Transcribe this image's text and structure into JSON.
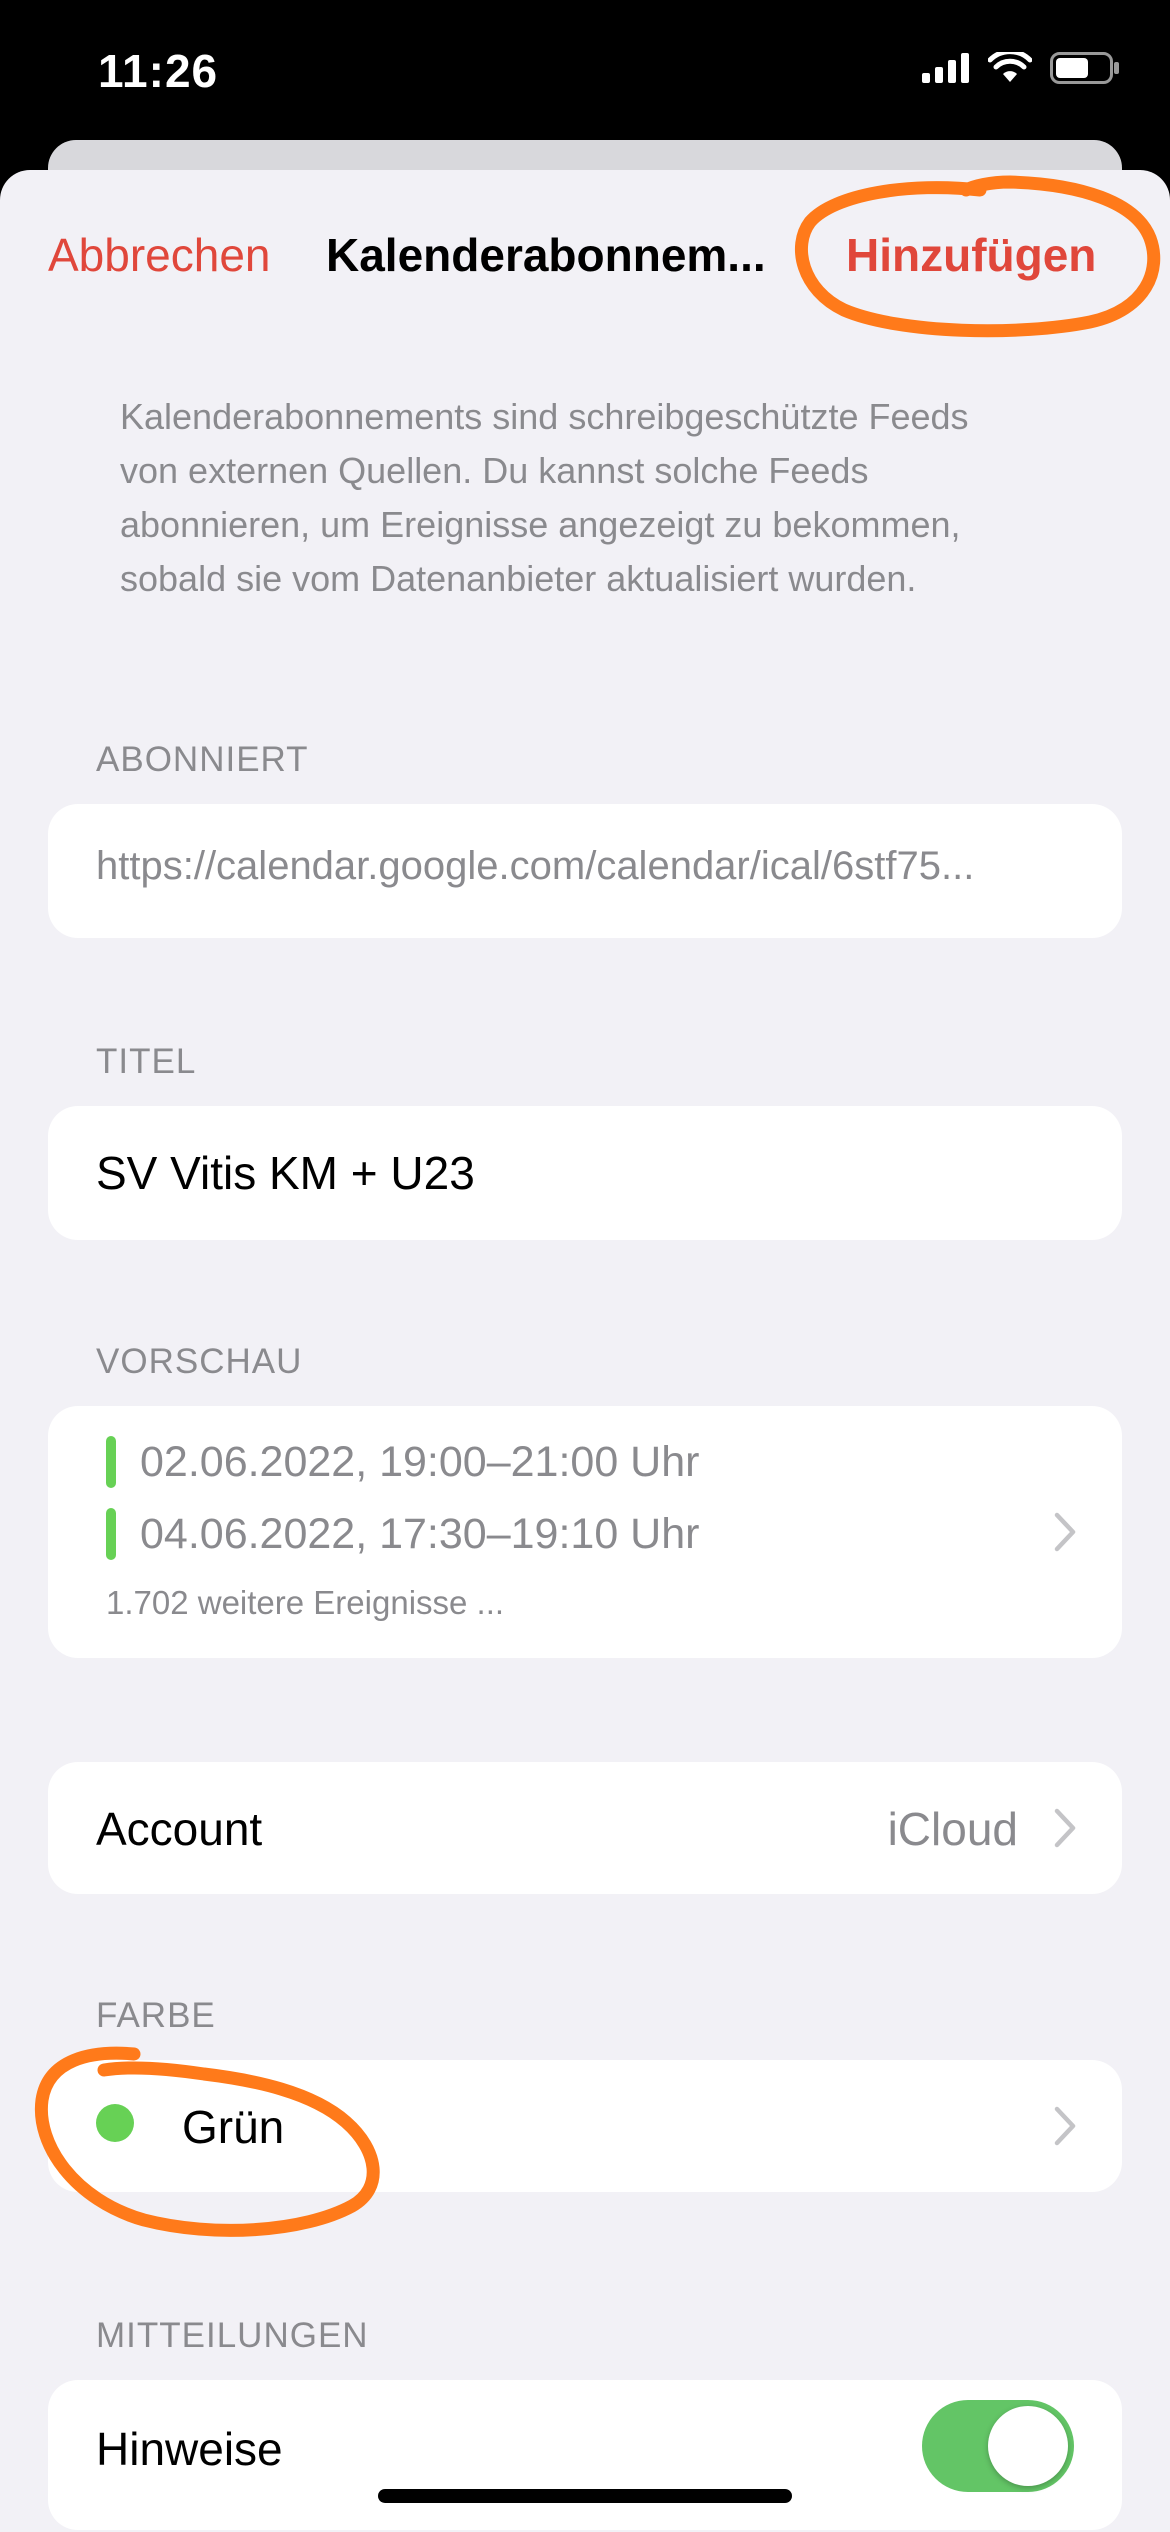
{
  "status_bar": {
    "time": "11:26",
    "icons": [
      "signal-icon",
      "wifi-icon",
      "battery-icon"
    ]
  },
  "nav": {
    "cancel_label": "Abbrechen",
    "title": "Kalenderabonnem...",
    "add_label": "Hinzufügen"
  },
  "intro_text": "Kalenderabonnements sind schreibgeschützte Feeds von externen Quellen. Du kannst solche Feeds abonnieren, um Ereignisse angezeigt zu bekommen, sobald sie vom Datenanbieter aktualisiert wurden.",
  "subscribed": {
    "label": "ABONNIERT",
    "url": "https://calendar.google.com/calendar/ical/6stf75..."
  },
  "title_section": {
    "label": "TITEL",
    "value": "SV Vitis KM + U23"
  },
  "preview": {
    "label": "VORSCHAU",
    "events": [
      "02.06.2022, 19:00–21:00 Uhr",
      "04.06.2022, 17:30–19:10 Uhr"
    ],
    "more": "1.702 weitere Ereignisse ..."
  },
  "account": {
    "label": "Account",
    "value": "iCloud"
  },
  "color": {
    "label": "FARBE",
    "value": "Grün",
    "swatch": "#67d155"
  },
  "notifications": {
    "label": "MITTEILUNGEN",
    "row_label": "Hinweise",
    "enabled": true
  },
  "colors": {
    "accent": "#e0473b",
    "annotation": "#ff7a1a",
    "toggle_on": "#63c566"
  }
}
